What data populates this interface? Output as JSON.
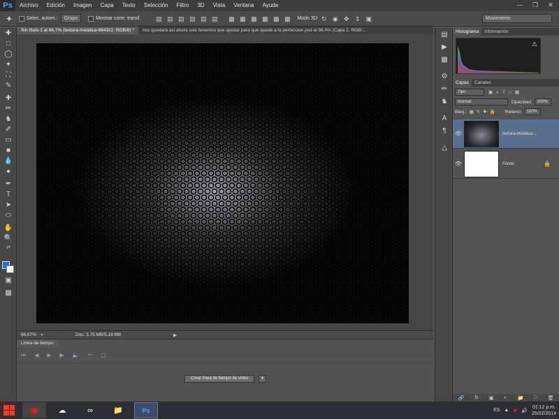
{
  "app": {
    "logo": "Ps"
  },
  "menu": [
    "Archivo",
    "Edición",
    "Imagen",
    "Capa",
    "Texto",
    "Selección",
    "Filtro",
    "3D",
    "Vista",
    "Ventana",
    "Ayuda"
  ],
  "options_bar": {
    "auto_select_label": "Selec. autom.:",
    "auto_select_value": "Grupo",
    "transform_controls_label": "Mostrar contr. transf.",
    "mode_3d_label": "Modo 3D:",
    "workspace": "Movimiento"
  },
  "tabs": [
    {
      "label": "Sin título-1 al 66,7% (textura-metalica-664322, RGB/8) *",
      "active": true
    },
    {
      "label": "nos quedara asi ahora solo tenemos que ajustar para que quede a la perfeccion.psd al 98,4% (Capa 2, RGB/...",
      "active": false
    }
  ],
  "status": {
    "zoom": "66,67%",
    "doc": "Doc: 3,75 MB/5,18 MB"
  },
  "timeline": {
    "tab": "Línea de tiempo",
    "create_button": "Crear línea de tiempo de vídeo"
  },
  "panels": {
    "top_tabs": [
      "Histograma",
      "Información"
    ],
    "layer_tabs": [
      "Capas",
      "Canales"
    ],
    "filter_kind": "Tipo",
    "blend_mode": "Normal",
    "opacity_label": "Opacidad:",
    "opacity_value": "100%",
    "lock_label": "Bloq.:",
    "fill_label": "Relleno:",
    "fill_value": "100%"
  },
  "layers": [
    {
      "name": "textura-metalica-...",
      "selected": true
    },
    {
      "name": "Fondo",
      "selected": false
    }
  ],
  "taskbar": {
    "lang": "ES",
    "time": "01:12 p.m.",
    "date": "25/02/2014"
  },
  "colors": {
    "foreground": "#1b6fd8",
    "background": "#ffffff",
    "selected_layer": "#5a6f8e"
  }
}
